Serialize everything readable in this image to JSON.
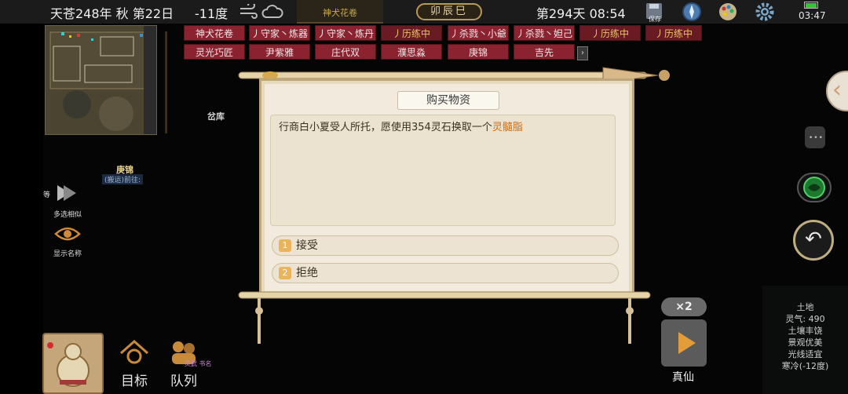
{
  "topbar": {
    "era": "天苍248年 秋 第22日",
    "temperature": "-11度",
    "weather_icons": [
      "wind-icon",
      "cloud-icon"
    ],
    "banner": "神犬花卷",
    "zodiac": "卯辰巳",
    "day_time": "第294天 08:54",
    "save_label": "保存",
    "clock": "03:47"
  },
  "tabs": {
    "row1": [
      "神犬花卷",
      "丿守家丶炼器",
      "丿守家丶炼丹",
      "丿历练中",
      "丿杀戮丶小爺",
      "丿杀戮丶妲己",
      "丿历练中",
      "丿历练中"
    ],
    "row2": [
      "灵光巧匠",
      "尹紫雅",
      "庄代双",
      "濮思淼",
      "庚锦",
      "吉先"
    ],
    "more": "›"
  },
  "map": {
    "label": "岔库",
    "npc_name": "庚锦",
    "npc_task": "(搬运)前往:"
  },
  "side": {
    "multi_select": "多选相似",
    "multi_prefix": "等",
    "show_names": "显示名称"
  },
  "bottom": {
    "goal": "目标",
    "team": "队列",
    "team_sub": "灵武 书名"
  },
  "dialog": {
    "title": "购买物资",
    "message_prefix": "行商白小夏受人所托，愿使用354灵石换取一个",
    "message_item": "灵髓脂",
    "options": [
      {
        "num": "1",
        "label": "接受"
      },
      {
        "num": "2",
        "label": "拒绝"
      }
    ]
  },
  "controls": {
    "speed": "×2",
    "realm": "真仙"
  },
  "tile_info": {
    "title": "土地",
    "lines": [
      "灵气: 490",
      "土壤丰饶",
      "景观优美",
      "光线适宜",
      "寒冷(-12度)"
    ]
  },
  "colors": {
    "tab_red": "#8b2230",
    "highlight": "#c9711c",
    "option_badge": "#e9b45b"
  }
}
